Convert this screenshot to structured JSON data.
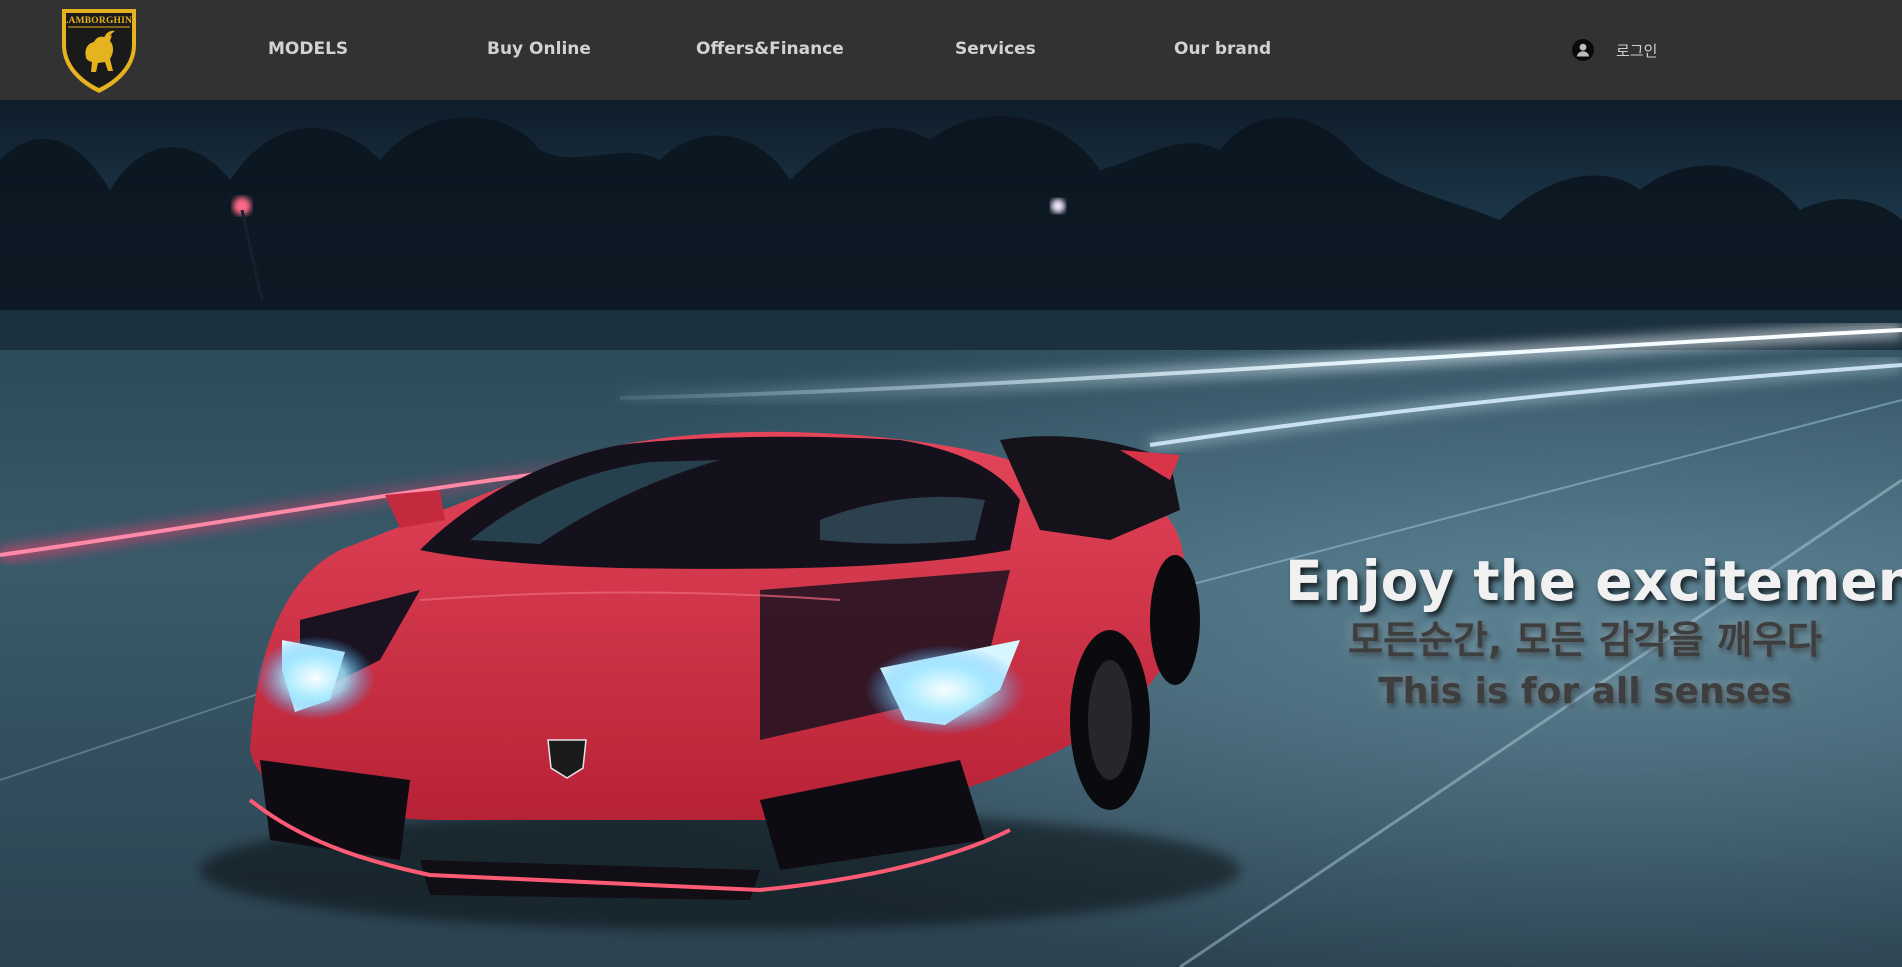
{
  "header": {
    "logo_text": "LAMBORGHINI",
    "nav": [
      {
        "label": "MODELS"
      },
      {
        "label": "Buy Online"
      },
      {
        "label": "Offers&Finance"
      },
      {
        "label": "Services"
      },
      {
        "label": "Our brand"
      }
    ],
    "login_label": "로그인",
    "login_icon": "user-circle-icon"
  },
  "hero": {
    "headline": "Enjoy the excitement",
    "subline_ko": "모든순간, 모든 감각을 깨우다",
    "subline_en": "This is for all senses"
  },
  "colors": {
    "header_bg": "#323232",
    "nav_text": "#d2d2d2",
    "logo_gold": "#e6b320",
    "car_red": "#d8344a",
    "headlight_blue": "#9fe8ff"
  }
}
